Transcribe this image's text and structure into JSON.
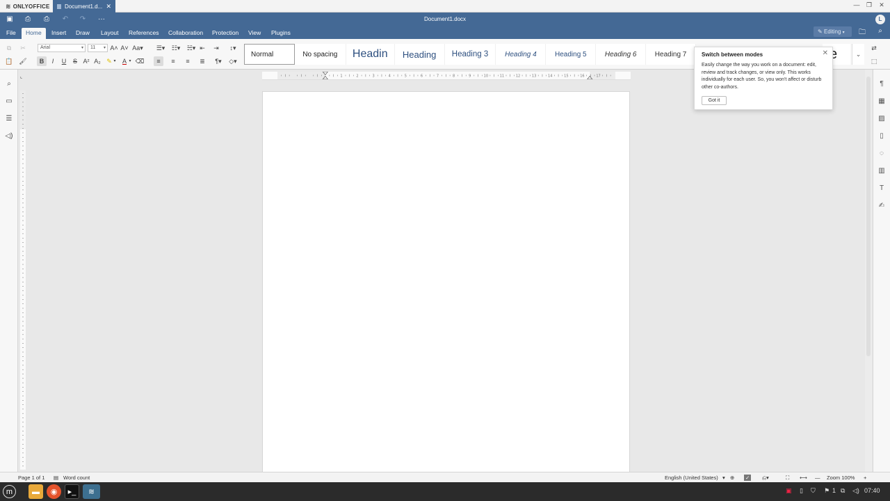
{
  "appbar": {
    "brand": "ONLYOFFICE",
    "tab_label": "Document1.d...",
    "tab_close": "✕",
    "window_controls": [
      "—",
      "❐",
      "✕"
    ]
  },
  "header": {
    "doc_title": "Document1.docx",
    "avatar_initial": "L",
    "quick_access_more": "···",
    "menu": [
      "File",
      "Home",
      "Insert",
      "Draw",
      "Layout",
      "References",
      "Collaboration",
      "Protection",
      "View",
      "Plugins"
    ],
    "active_menu": "Home",
    "editing_label": "Editing"
  },
  "toolbar": {
    "font_name": "Arial",
    "font_size": "11",
    "styles": [
      "Normal",
      "No spacing",
      "Headin",
      "Heading",
      "Heading 3",
      "Heading 4",
      "Heading 5",
      "Heading 6",
      "Heading 7"
    ],
    "partial_style_glyph": "e"
  },
  "popup": {
    "title": "Switch between modes",
    "body": "Easily change the way you work on a document: edit, review and track changes, or view only. This works individually for each user. So, you won't affect or disturb other co-authors.",
    "button": "Got it"
  },
  "ruler": {
    "ticks": [
      "1",
      "2",
      "3",
      "4",
      "5",
      "6",
      "7",
      "8",
      "9",
      "10",
      "11",
      "12",
      "13",
      "14",
      "15",
      "16",
      "17"
    ]
  },
  "status": {
    "page": "Page 1 of 1",
    "word_count": "Word count",
    "language": "English (United States)",
    "zoom": "Zoom 100%"
  },
  "taskbar": {
    "time": "07:40",
    "tray_badge": "1"
  }
}
